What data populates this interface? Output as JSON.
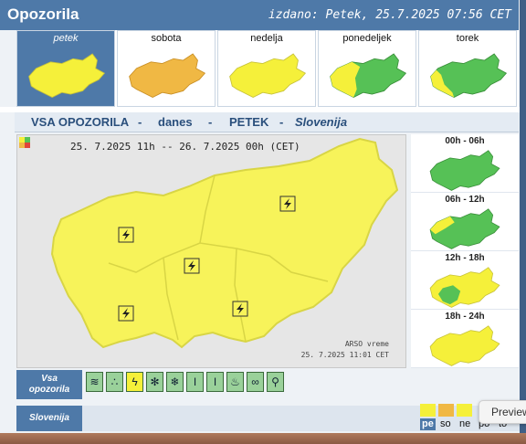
{
  "header": {
    "title": "Opozorila",
    "issued": "izdano: Petek, 25.7.2025 07:56 CET"
  },
  "days": [
    {
      "label": "petek",
      "active": true,
      "fill": "#f5f03a"
    },
    {
      "label": "sobota",
      "active": false,
      "fill": "#f0b844"
    },
    {
      "label": "nedelja",
      "active": false,
      "fill": "#f5f03a"
    },
    {
      "label": "ponedeljek",
      "active": false,
      "fill": "#56c156",
      "fill2": "#f5f03a"
    },
    {
      "label": "torek",
      "active": false,
      "fill": "#56c156",
      "fill2": "#f5f03a"
    }
  ],
  "section": {
    "all": "VSA OPOZORILA",
    "dash1": "-",
    "today": "danes",
    "dash2": "-",
    "day": "PETEK",
    "dash3": "-",
    "region": "Slovenija"
  },
  "map": {
    "title": "25. 7.2025  11h -- 26. 7.2025  00h    (CET)",
    "credit_line1": "ARSO vreme",
    "credit_line2": "25. 7.2025  11:01 CET",
    "fill": "#f7f35a",
    "border": "#d8d545"
  },
  "slots": [
    {
      "label": "00h - 06h",
      "fill": "#56c156"
    },
    {
      "label": "06h - 12h",
      "fill": "#56c156",
      "fill2": "#f5f03a"
    },
    {
      "label": "12h - 18h",
      "fill": "#f5f03a",
      "fill2": "#56c156"
    },
    {
      "label": "18h - 24h",
      "fill": "#f5f03a"
    }
  ],
  "bottom": {
    "all_label_1": "Vsa",
    "all_label_2": "opozorila",
    "region_label": "Slovenija",
    "icons": [
      "wind-icon",
      "rain-icon",
      "thunderstorm-icon",
      "snow-icon",
      "ice-icon",
      "heat-icon",
      "cold-icon",
      "fire-icon",
      "fog-icon",
      "flood-icon"
    ],
    "tabs": [
      "pe",
      "so",
      "ne",
      "po",
      "to"
    ],
    "preview": "Preview"
  }
}
